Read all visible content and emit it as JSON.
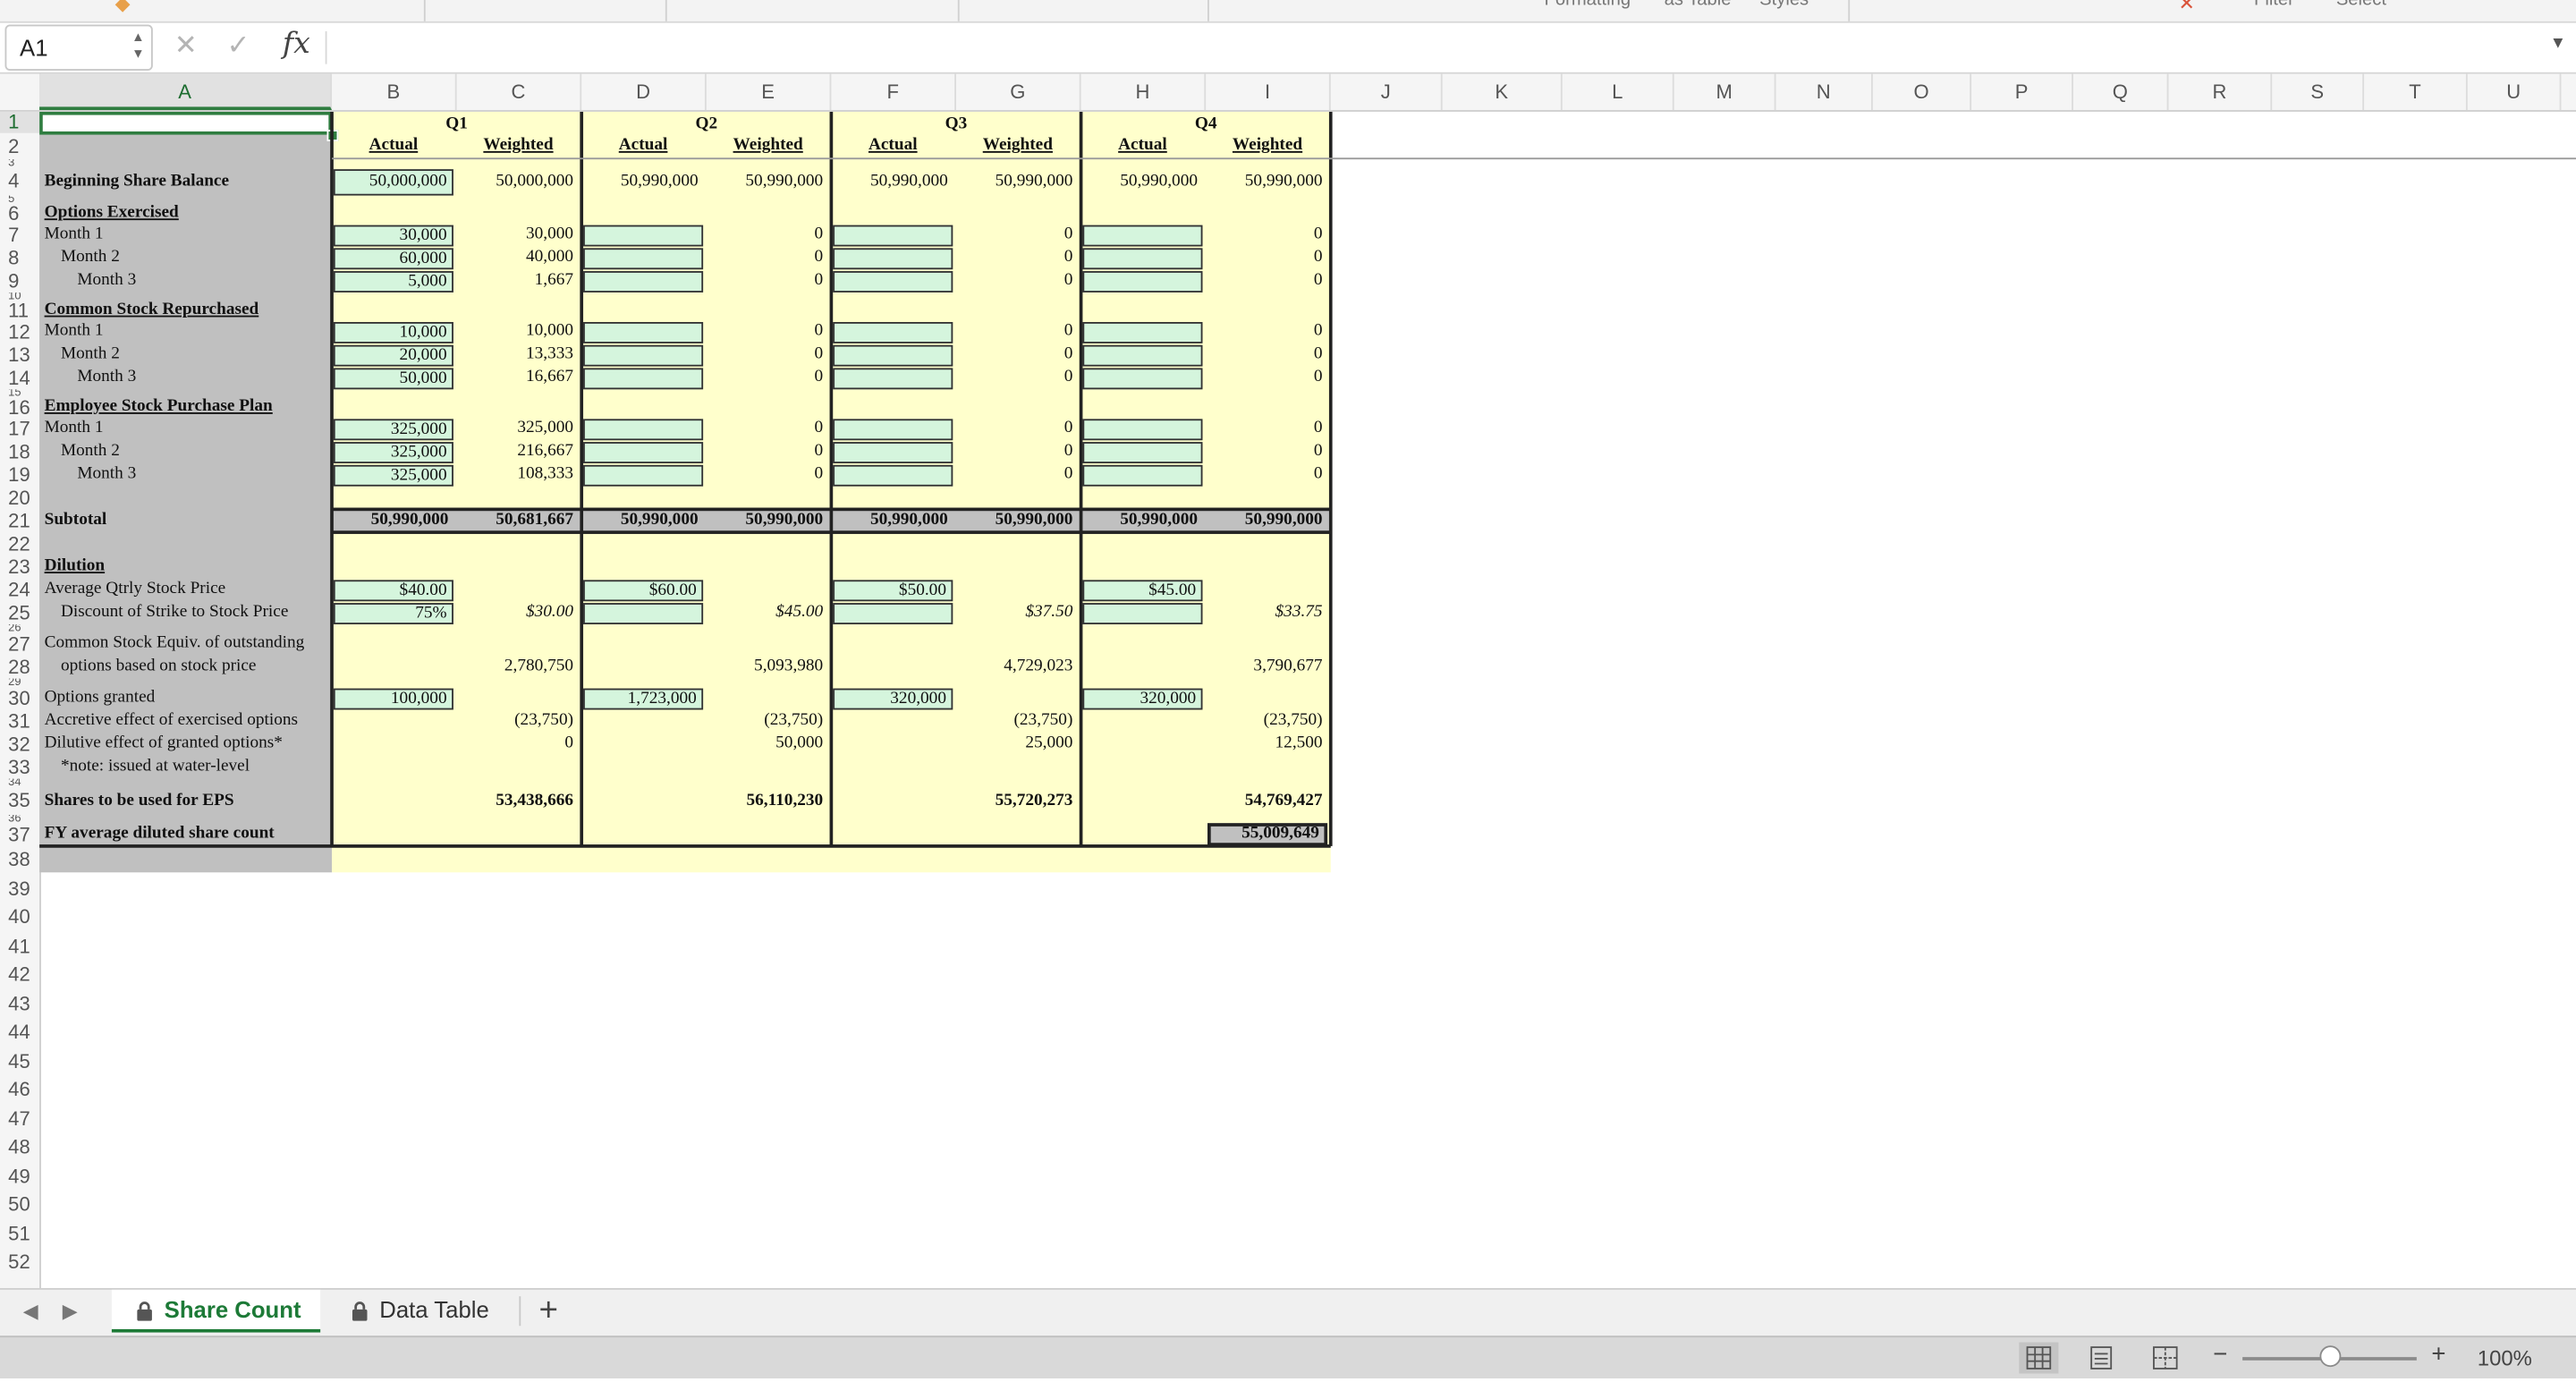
{
  "ribbon": {
    "fragments": [
      "Formatting",
      "as Table",
      "Styles",
      "Filter",
      "Select"
    ]
  },
  "formula_bar": {
    "cell_ref": "A1",
    "cancel_icon": "✕",
    "enter_icon": "✓",
    "fx_label": "fx",
    "content": ""
  },
  "columns": [
    "A",
    "B",
    "C",
    "D",
    "E",
    "F",
    "G",
    "H",
    "I",
    "J",
    "K",
    "L",
    "M",
    "N",
    "O",
    "P",
    "Q",
    "R",
    "S",
    "T",
    "U"
  ],
  "rows": [
    "1",
    "2",
    "3",
    "4",
    "5",
    "6",
    "7",
    "8",
    "9",
    "10",
    "11",
    "12",
    "13",
    "14",
    "15",
    "16",
    "17",
    "18",
    "19",
    "20",
    "21",
    "22",
    "23",
    "24",
    "25",
    "26",
    "27",
    "28",
    "29",
    "30",
    "31",
    "32",
    "33",
    "34",
    "35",
    "36",
    "37",
    "38",
    "39",
    "40",
    "41",
    "42",
    "43",
    "44",
    "45",
    "46",
    "47",
    "48",
    "49",
    "50",
    "51",
    "52"
  ],
  "selected_cell": "A1",
  "sheet": {
    "quarters": [
      "Q1",
      "Q2",
      "Q3",
      "Q4"
    ],
    "sub_headers": {
      "actual": "Actual",
      "weighted": "Weighted"
    },
    "labels": {
      "beginning": "Beginning Share Balance",
      "options_exercised": "Options Exercised",
      "month1": "Month 1",
      "month2": "Month 2",
      "month3": "Month 3",
      "repurchased": "Common Stock Repurchased",
      "espp": "Employee Stock Purchase Plan",
      "subtotal": "Subtotal",
      "dilution": "Dilution",
      "avg_price": "Average Qtrly Stock Price",
      "discount": "Discount of Strike to Stock Price",
      "cse_line1": "Common Stock Equiv. of outstanding",
      "cse_line2": "options based on stock price",
      "options_granted": "Options granted",
      "accretive": "Accretive effect of exercised options",
      "dilutive": "Dilutive effect of granted options*",
      "note": "*note: issued at water-level",
      "shares_eps": "Shares to be used for EPS",
      "fy_avg": "FY average diluted share count"
    },
    "q1": {
      "begin_actual": "50,000,000",
      "begin_weighted": "50,000,000",
      "ex_actual": [
        "30,000",
        "60,000",
        "5,000"
      ],
      "ex_weighted": [
        "30,000",
        "40,000",
        "1,667"
      ],
      "rep_actual": [
        "10,000",
        "20,000",
        "50,000"
      ],
      "rep_weighted": [
        "10,000",
        "13,333",
        "16,667"
      ],
      "espp_actual": [
        "325,000",
        "325,000",
        "325,000"
      ],
      "espp_weighted": [
        "325,000",
        "216,667",
        "108,333"
      ],
      "subtotal_actual": "50,990,000",
      "subtotal_weighted": "50,681,667",
      "avg_price": "$40.00",
      "discount": "75%",
      "strike": "$30.00",
      "cse": "2,780,750",
      "granted": "100,000",
      "accretive": "(23,750)",
      "dilutive": "0",
      "shares_eps": "53,438,666"
    },
    "q2": {
      "begin_actual": "50,990,000",
      "begin_weighted": "50,990,000",
      "ex_weighted": [
        "0",
        "0",
        "0"
      ],
      "rep_weighted": [
        "0",
        "0",
        "0"
      ],
      "espp_weighted": [
        "0",
        "0",
        "0"
      ],
      "subtotal_actual": "50,990,000",
      "subtotal_weighted": "50,990,000",
      "avg_price": "$60.00",
      "strike": "$45.00",
      "cse": "5,093,980",
      "granted": "1,723,000",
      "accretive": "(23,750)",
      "dilutive": "50,000",
      "shares_eps": "56,110,230"
    },
    "q3": {
      "begin_actual": "50,990,000",
      "begin_weighted": "50,990,000",
      "ex_weighted": [
        "0",
        "0",
        "0"
      ],
      "rep_weighted": [
        "0",
        "0",
        "0"
      ],
      "espp_weighted": [
        "0",
        "0",
        "0"
      ],
      "subtotal_actual": "50,990,000",
      "subtotal_weighted": "50,990,000",
      "avg_price": "$50.00",
      "strike": "$37.50",
      "cse": "4,729,023",
      "granted": "320,000",
      "accretive": "(23,750)",
      "dilutive": "25,000",
      "shares_eps": "55,720,273"
    },
    "q4": {
      "begin_actual": "50,990,000",
      "begin_weighted": "50,990,000",
      "ex_weighted": [
        "0",
        "0",
        "0"
      ],
      "rep_weighted": [
        "0",
        "0",
        "0"
      ],
      "espp_weighted": [
        "0",
        "0",
        "0"
      ],
      "subtotal_actual": "50,990,000",
      "subtotal_weighted": "50,990,000",
      "avg_price": "$45.00",
      "strike": "$33.75",
      "cse": "3,790,677",
      "granted": "320,000",
      "accretive": "(23,750)",
      "dilutive": "12,500",
      "shares_eps": "54,769,427",
      "fy_avg": "55,009,649"
    }
  },
  "tabs": [
    {
      "label": "Share Count",
      "active": true
    },
    {
      "label": "Data Table",
      "active": false
    }
  ],
  "tab_nav": {
    "prev": "◀",
    "next": "▶",
    "add": "+"
  },
  "zoom": {
    "label": "100%",
    "minus": "−",
    "plus": "+"
  },
  "colors": {
    "label_bg": "#c0c0c0",
    "data_bg": "#ffffcc",
    "input_bg": "#d5f5dd",
    "accent": "#1d7a37"
  }
}
